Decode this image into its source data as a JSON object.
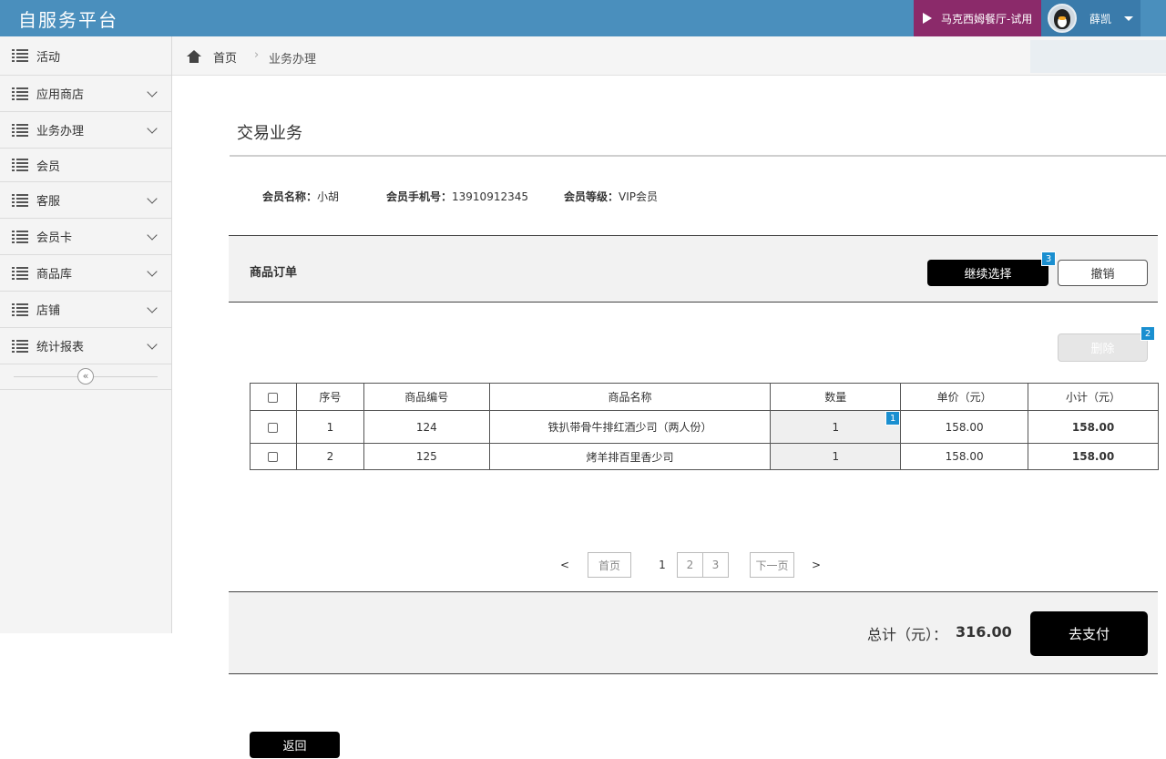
{
  "header": {
    "brand": "自服务平台",
    "store_label": "马克西姆餐厅-试用",
    "user_name": "薛凯"
  },
  "sidebar": {
    "items": [
      {
        "label": "活动",
        "expandable": false
      },
      {
        "label": "应用商店",
        "expandable": true
      },
      {
        "label": "业务办理",
        "expandable": true
      },
      {
        "label": "会员",
        "expandable": false
      },
      {
        "label": "客服",
        "expandable": true
      },
      {
        "label": "会员卡",
        "expandable": true
      },
      {
        "label": "商品库",
        "expandable": true
      },
      {
        "label": "店铺",
        "expandable": true
      },
      {
        "label": "统计报表",
        "expandable": true
      }
    ],
    "collapse_glyph": "«"
  },
  "breadcrumb": {
    "home": "首页",
    "separator": "›",
    "current": "业务办理"
  },
  "page": {
    "title": "交易业务"
  },
  "member": {
    "name_label": "会员名称：",
    "name_value": "小胡",
    "phone_label": "会员手机号：",
    "phone_value": "13910912345",
    "level_label": "会员等级：",
    "level_value": "VIP会员"
  },
  "order": {
    "title": "商品订单",
    "continue_label": "继续选择",
    "continue_badge": "3",
    "cancel_label": "撤销",
    "delete_label": "删除",
    "delete_badge": "2",
    "columns": [
      "序号",
      "商品编号",
      "商品名称",
      "数量",
      "单价（元）",
      "小计（元）"
    ],
    "rows": [
      {
        "index": "1",
        "code": "124",
        "name": "铁扒带骨牛排红酒少司（两人份）",
        "qty": "1",
        "price": "158.00",
        "subtotal": "158.00",
        "badge": "1"
      },
      {
        "index": "2",
        "code": "125",
        "name": "烤羊排百里香少司",
        "qty": "1",
        "price": "158.00",
        "subtotal": "158.00"
      }
    ]
  },
  "pagination": {
    "prev": "<",
    "first": "首页",
    "pages": [
      "1",
      "2",
      "3"
    ],
    "current": "1",
    "next_label": "下一页",
    "next": ">"
  },
  "summary": {
    "total_label": "总计（元）：",
    "total_value": "316.00",
    "pay_label": "去支付"
  },
  "footer": {
    "back_label": "返回"
  },
  "colors": {
    "topbar": "#4a8fbd",
    "store_button": "#8b2a6a",
    "badge": "#1a8fd0",
    "primary_button": "#000000"
  }
}
